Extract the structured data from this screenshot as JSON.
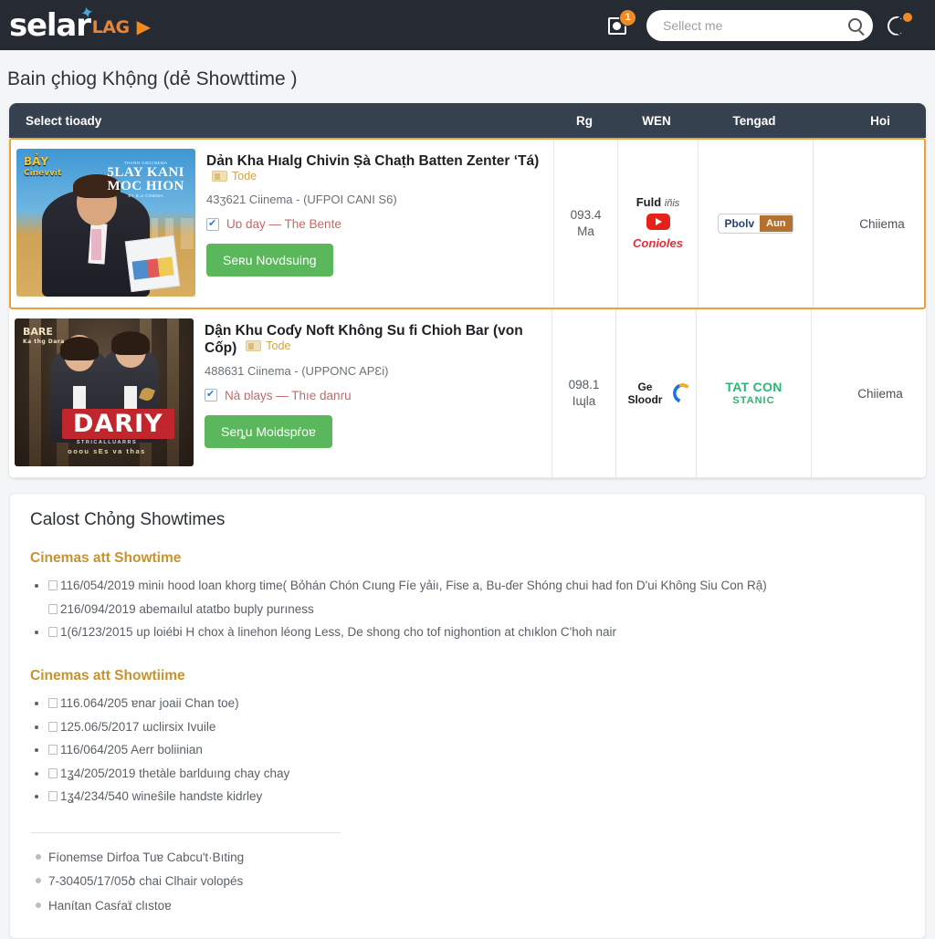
{
  "header": {
    "brand_main": "selar",
    "brand_sub": "LAG",
    "play_icon": "play-triangle-icon",
    "message_badge": "1",
    "search_placeholder": "Sellect me",
    "search_value": "",
    "search_icon": "search-icon",
    "theme_icon": "moon-icon"
  },
  "page": {
    "title": "Bain çhiog Khộng (dẻ Showttime )"
  },
  "table": {
    "columns": [
      {
        "key": "main",
        "label": "Select tioady"
      },
      {
        "key": "rg",
        "label": "Rg"
      },
      {
        "key": "wen",
        "label": "WEN"
      },
      {
        "key": "tengad",
        "label": "Tengad"
      },
      {
        "key": "hoi",
        "label": "Hoi"
      }
    ],
    "rows": [
      {
        "highlighted": true,
        "poster_alt": "BẢY Cinemvit - 5LAY KANI MOC HION",
        "poster_badge": "BẢY",
        "poster_badge_sub": "Cinevvit",
        "poster_credit_top": "THANH VIECINEMA",
        "poster_credit_l1": "5LAY KANI",
        "poster_credit_l2": "MOC HION",
        "poster_credit_bottom": "BY B.U CINEMA",
        "title": "Dản Kha Hıalg Chivin Ṣà Chaṭh Batten Zenter ʻTá)",
        "tag": "Tode",
        "tag_icon": "ticket-icon",
        "subtitle": "43ʒ621 Ciinema - (UFPOI CANI S6)",
        "check_label": "Uɒ day — The Bente",
        "button": "Seʀu Novdsuing",
        "rg": "093.4\nMa",
        "wen_logo": {
          "line1": "Fuld",
          "line1_italic": "iñis",
          "icon": "youtube-icon",
          "line3": "Conioles"
        },
        "tengad_logo": {
          "left": "Pbolv",
          "right": "Aun"
        },
        "hoi": "Chiiema"
      },
      {
        "highlighted": false,
        "poster_alt": "DARIY",
        "poster_badge": "BARE",
        "poster_badge_sub": "Ka thg Dara",
        "poster_logo": "DARIY",
        "poster_sub_top": "STRICALLUARRS",
        "poster_sub": "ooou sEs va thas",
        "title": "Dận Khu Coɗy Noft Không Su fi Chioh Bar (von Cốp)",
        "tag": "Tode",
        "tag_icon": "ticket-icon",
        "subtitle": "488631 Ciinema - (UPPONC APƐi)",
        "check_label": "Nà ɒlays — Thıe danɾu",
        "button": "Seȵu Moidspŕoɐ",
        "rg": "098.1\nIɰla",
        "wen_logo": {
          "text": "Ge Sloodr",
          "icon": "swoosh-icon"
        },
        "tengad_logo": {
          "line1": "TAT CON",
          "line2": "STANIC"
        },
        "hoi": "Chiiema"
      }
    ]
  },
  "panel": {
    "title": "Calost Chỏng Showtimes",
    "sections": [
      {
        "heading": "Cinemas att Showtime",
        "items": [
          {
            "bullet": true,
            "text": "116/054/2019 miniı hood loan khorg time( Bỏhán Chón Cıung Fíe yảiı, Fise a, Bu-ɗer Shóng chui had fon Dʹui Không Siu Con Rậ)"
          },
          {
            "bullet": false,
            "text": "216/094/2019 abemaılul atatbo buply purıness"
          },
          {
            "bullet": true,
            "text": "1(6/123/2015 up loiébi H chox à linehon léong Less, De shong cho tof nighontion at chıklon Cʹhoh nair"
          }
        ]
      },
      {
        "heading": "Cinemas att Showtiime",
        "items": [
          {
            "bullet": true,
            "text": "116.064/205 ɐnar joaii Chan toe)"
          },
          {
            "bullet": true,
            "text": "125.06/5/2017 ɯclirsix Ivuile"
          },
          {
            "bullet": true,
            "text": "116/064/205 Aerr boliinian"
          },
          {
            "bullet": true,
            "text": "1ʓ4/205/2019 thetàle barlduıng chay chay"
          },
          {
            "bullet": true,
            "text": "1ʓ4/234/540 wineŝile handste kidɾley"
          }
        ]
      }
    ],
    "footnotes": [
      "Fíonemse Dirfoa Tuɐ Cabcuʹt·Bıting",
      "7-30405/17/05ծ chai Clhair volopés",
      "Hanítan Casŕaɪ̈ clıstoɐ"
    ]
  }
}
